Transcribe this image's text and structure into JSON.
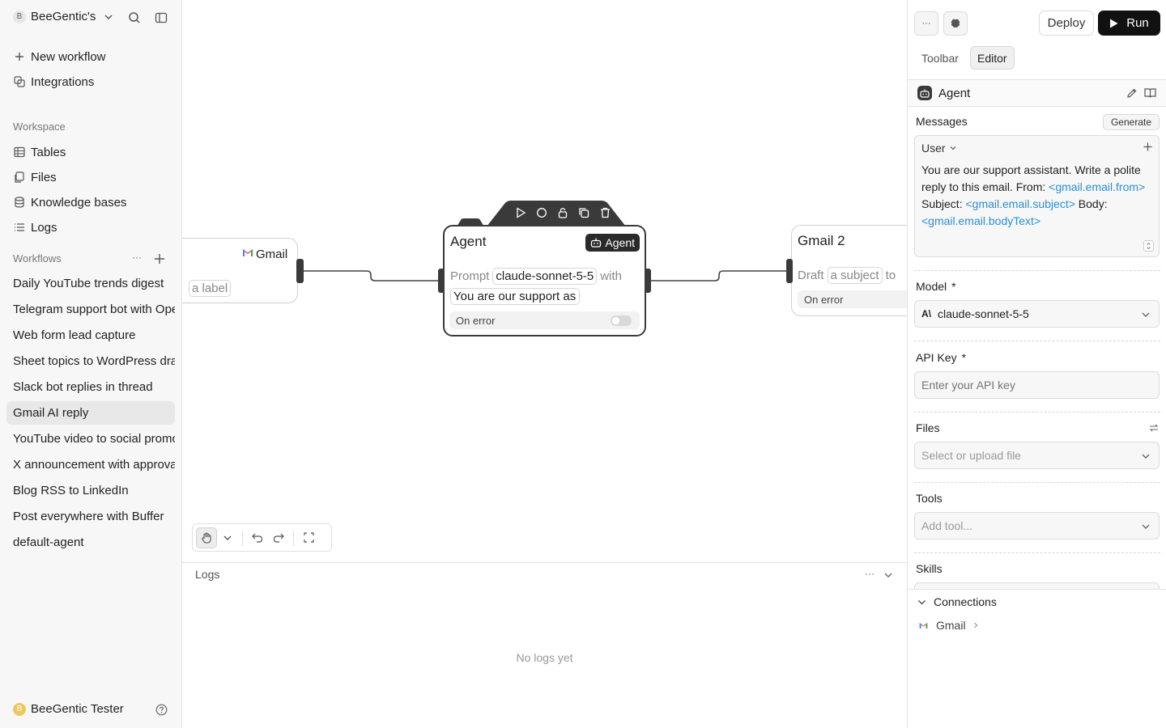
{
  "sidebar": {
    "workspace_badge": "B",
    "workspace_name": "BeeGentic's",
    "new_workflow": "New workflow",
    "integrations": "Integrations",
    "workspace_label": "Workspace",
    "tables": "Tables",
    "files": "Files",
    "knowledge_bases": "Knowledge bases",
    "logs": "Logs",
    "workflows_label": "Workflows",
    "workflows": [
      "Daily YouTube trends digest",
      "Telegram support bot with OpenAI",
      "Web form lead capture",
      "Sheet topics to WordPress drafts",
      "Slack bot replies in thread",
      "Gmail AI reply",
      "YouTube video to social promo",
      "X announcement with approval",
      "Blog RSS to LinkedIn",
      "Post everywhere with Buffer",
      "default-agent"
    ],
    "active_workflow_index": 5,
    "user_badge": "B",
    "user_name": "BeeGentic Tester"
  },
  "canvas": {
    "trigger_node": {
      "title": "Gmail",
      "label_pill": "a label"
    },
    "agent_node": {
      "title": "Agent",
      "badge": "Agent",
      "prompt_word": "Prompt",
      "model_pill": "claude-sonnet-5-5",
      "with_word": "with",
      "message_pill": "You are our support as",
      "on_error": "On error"
    },
    "gmail2_node": {
      "title": "Gmail 2",
      "draft_word": "Draft",
      "subject_pill": "a subject",
      "to_word": "to",
      "on_error": "On error"
    }
  },
  "logs": {
    "title": "Logs",
    "empty": "No logs yet"
  },
  "right_panel": {
    "more_label": "···",
    "deploy": "Deploy",
    "run": "Run",
    "tabs": [
      "Toolbar",
      "Editor"
    ],
    "active_tab": "Editor",
    "block_title": "Agent",
    "messages_label": "Messages",
    "generate": "Generate",
    "role": "User",
    "message_parts": {
      "intro": "You are our support assistant. Write a polite reply to this email. From: ",
      "from_var": "<gmail.email.from>",
      "subject_word": " Subject: ",
      "subject_var": "<gmail.email.subject>",
      "body_word": " Body: ",
      "body_var": "<gmail.email.bodyText>"
    },
    "model_label": "Model",
    "model_value": "claude-sonnet-5-5",
    "api_key_label": "API Key",
    "api_key_placeholder": "Enter your API key",
    "files_label": "Files",
    "files_placeholder": "Select or upload file",
    "tools_label": "Tools",
    "tools_placeholder": "Add tool...",
    "skills_label": "Skills",
    "required_mark": "*",
    "connections_label": "Connections",
    "connection_item": "Gmail"
  },
  "colors": {
    "accent_dark": "#111111",
    "variable_blue": "#2a8fd6",
    "node_selected_border": "#3a3a3a"
  }
}
